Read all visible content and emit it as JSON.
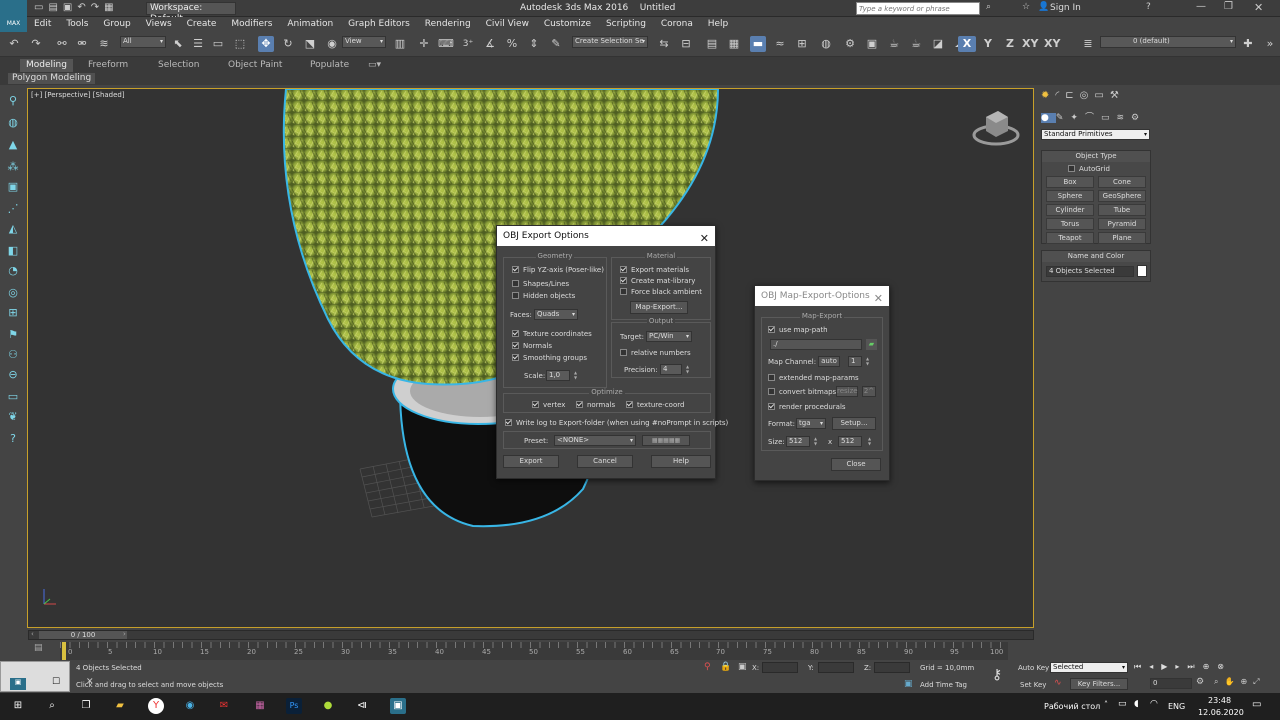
{
  "window": {
    "title": "Autodesk 3ds Max 2016",
    "doc": "Untitled",
    "workspace": "Workspace: Default",
    "search_placeholder": "Type a keyword or phrase",
    "sign_in": "Sign In",
    "app_badge": "MAX"
  },
  "menu": [
    "Edit",
    "Tools",
    "Group",
    "Views",
    "Create",
    "Modifiers",
    "Animation",
    "Graph Editors",
    "Rendering",
    "Civil View",
    "Customize",
    "Scripting",
    "Corona",
    "Help"
  ],
  "toolbar": {
    "filter": "All",
    "coord": "View",
    "selection_set": "Create Selection Se",
    "axes": [
      "X",
      "Y",
      "Z",
      "XY",
      "XY"
    ],
    "layer": "0 (default)"
  },
  "ribbon": {
    "tabs": [
      "Modeling",
      "Freeform",
      "Selection",
      "Object Paint",
      "Populate"
    ],
    "sub": "Polygon Modeling"
  },
  "viewport": {
    "label": "[+] [Perspective] [Shaded]"
  },
  "cmd_panel": {
    "category": "Standard Primitives",
    "object_type": "Object Type",
    "autogrid": "AutoGrid",
    "buttons": [
      "Box",
      "Cone",
      "Sphere",
      "GeoSphere",
      "Cylinder",
      "Tube",
      "Torus",
      "Pyramid",
      "Teapot",
      "Plane"
    ],
    "name_color": "Name and Color",
    "selected": "4 Objects Selected",
    "color": "#ffffff"
  },
  "obj_dialog": {
    "title": "OBJ Export Options",
    "geometry": "Geometry",
    "flip": "Flip YZ-axis (Poser-like)",
    "shapes": "Shapes/Lines",
    "hidden": "Hidden objects",
    "faces_label": "Faces:",
    "faces": "Quads",
    "texcoords": "Texture coordinates",
    "normals": "Normals",
    "smoothing": "Smoothing groups",
    "scale_label": "Scale:",
    "scale": "1,0",
    "material": "Material",
    "export_mat": "Export materials",
    "create_lib": "Create mat-library",
    "force_black": "Force black ambient",
    "map_export": "Map-Export...",
    "output": "Output",
    "target_label": "Target:",
    "target": "PC/Win",
    "relative": "relative numbers",
    "precision_label": "Precision:",
    "precision": "4",
    "optimize": "Optimize",
    "vertex": "vertex",
    "opt_normals": "normals",
    "texture_coord": "texture-coord",
    "log": "Write log to Export-folder (when using #noPrompt in scripts)",
    "preset_label": "Preset:",
    "preset": "<NONE>",
    "export": "Export",
    "cancel": "Cancel",
    "help": "Help"
  },
  "map_dialog": {
    "title": "OBJ Map-Export-Options",
    "group": "Map-Export",
    "use_path": "use map-path",
    "path": "./",
    "channel_label": "Map Channel:",
    "channel_auto": "auto",
    "channel": "1",
    "extended": "extended map-params",
    "convert": "convert bitmaps",
    "resize": "resize",
    "pow2": "2^",
    "render_proc": "render procedurals",
    "format_label": "Format:",
    "format": "tga",
    "setup": "Setup...",
    "size_label": "Size:",
    "size_w": "512",
    "size_x": "x",
    "size_h": "512",
    "close": "Close"
  },
  "timeline": {
    "frame": "0 / 100",
    "ticks": [
      "0",
      "5",
      "10",
      "15",
      "20",
      "25",
      "30",
      "35",
      "40",
      "45",
      "50",
      "55",
      "60",
      "65",
      "70",
      "75",
      "80",
      "85",
      "90",
      "95",
      "100"
    ]
  },
  "status": {
    "selected": "4 Objects Selected",
    "prompt": "Click and drag to select and move objects",
    "x": "X:",
    "y": "Y:",
    "z": "Z:",
    "grid": "Grid = 10,0mm",
    "add_time_tag": "Add Time Tag",
    "auto_key": "Auto Key",
    "set_key": "Set Key",
    "key_mode": "Selected",
    "key_filters": "Key Filters...",
    "frame_num": "0"
  },
  "taskbar": {
    "desktop": "Рабочий стол",
    "lang": "ENG",
    "time": "23:48",
    "date": "12.06.2020"
  }
}
